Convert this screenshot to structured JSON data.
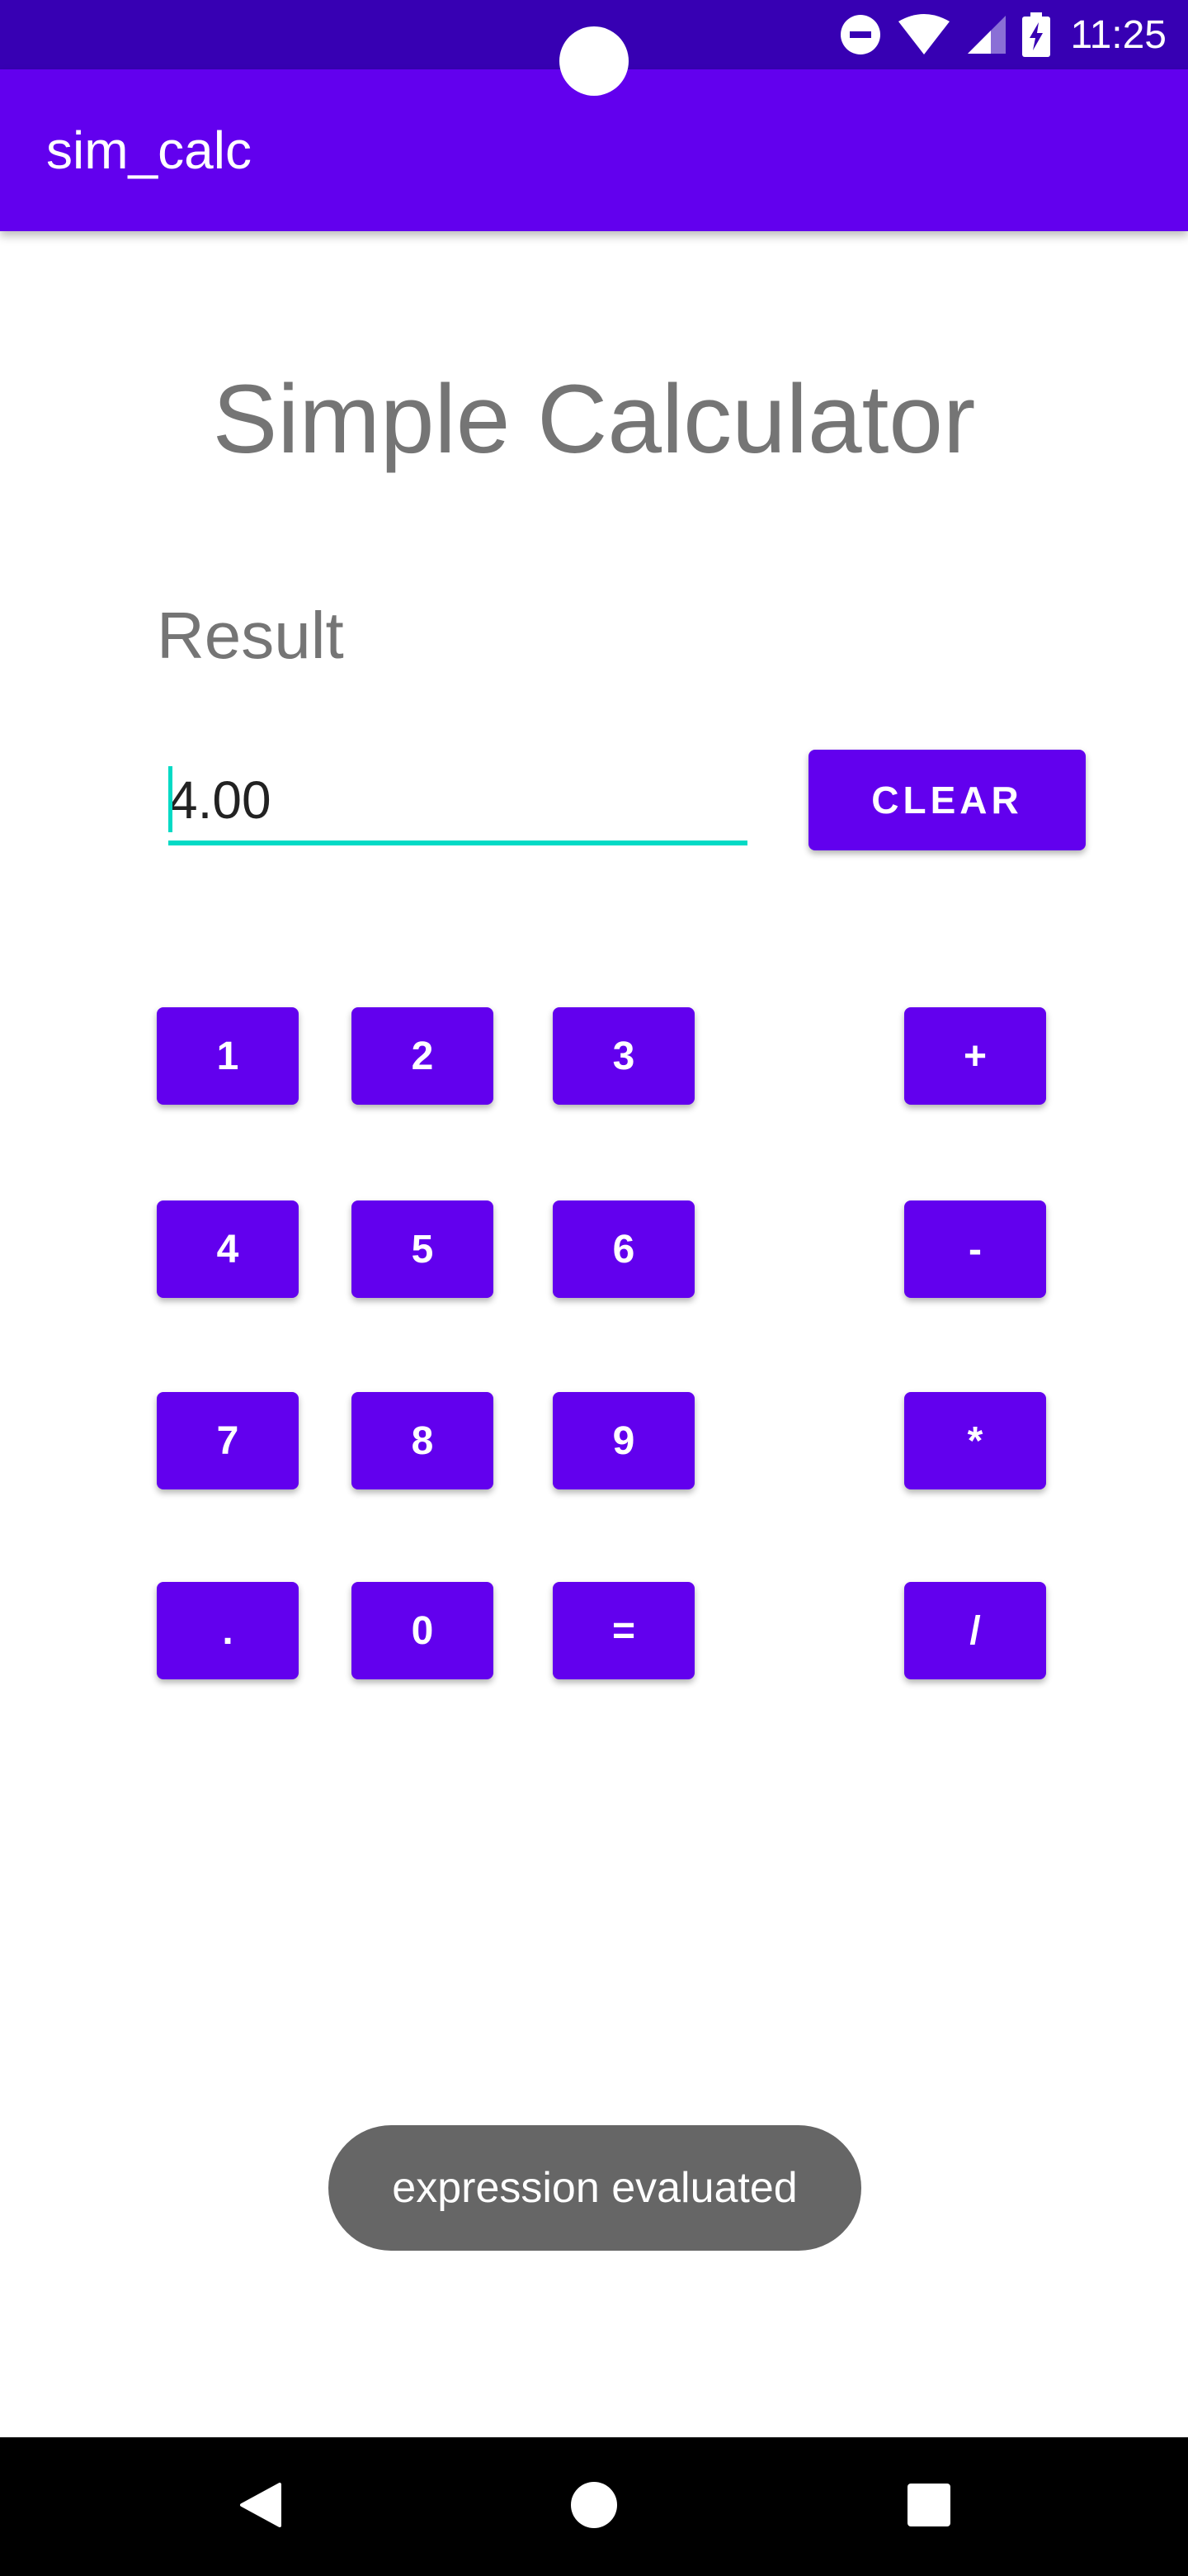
{
  "status_bar": {
    "time": "11:25",
    "icons": [
      "do-not-disturb-icon",
      "wifi-icon",
      "cell-signal-icon",
      "battery-charging-icon"
    ]
  },
  "app_bar": {
    "title": "sim_calc"
  },
  "main": {
    "heading": "Simple Calculator",
    "result_label": "Result",
    "result_value": "4.00",
    "clear_label": "CLEAR"
  },
  "keypad": {
    "k1": "1",
    "k2": "2",
    "k3": "3",
    "plus": "+",
    "k4": "4",
    "k5": "5",
    "k6": "6",
    "minus": "-",
    "k7": "7",
    "k8": "8",
    "k9": "9",
    "multiply": "*",
    "dot": ".",
    "k0": "0",
    "equals": "=",
    "divide": "/"
  },
  "toast": {
    "message": "expression evaluated"
  },
  "nav_bar": {
    "icons": [
      "back-icon",
      "home-icon",
      "recents-icon"
    ]
  },
  "colors": {
    "primary": "#6200ee",
    "primary_dark": "#3700b3",
    "accent": "#03dac5",
    "toast_bg": "#666666"
  }
}
